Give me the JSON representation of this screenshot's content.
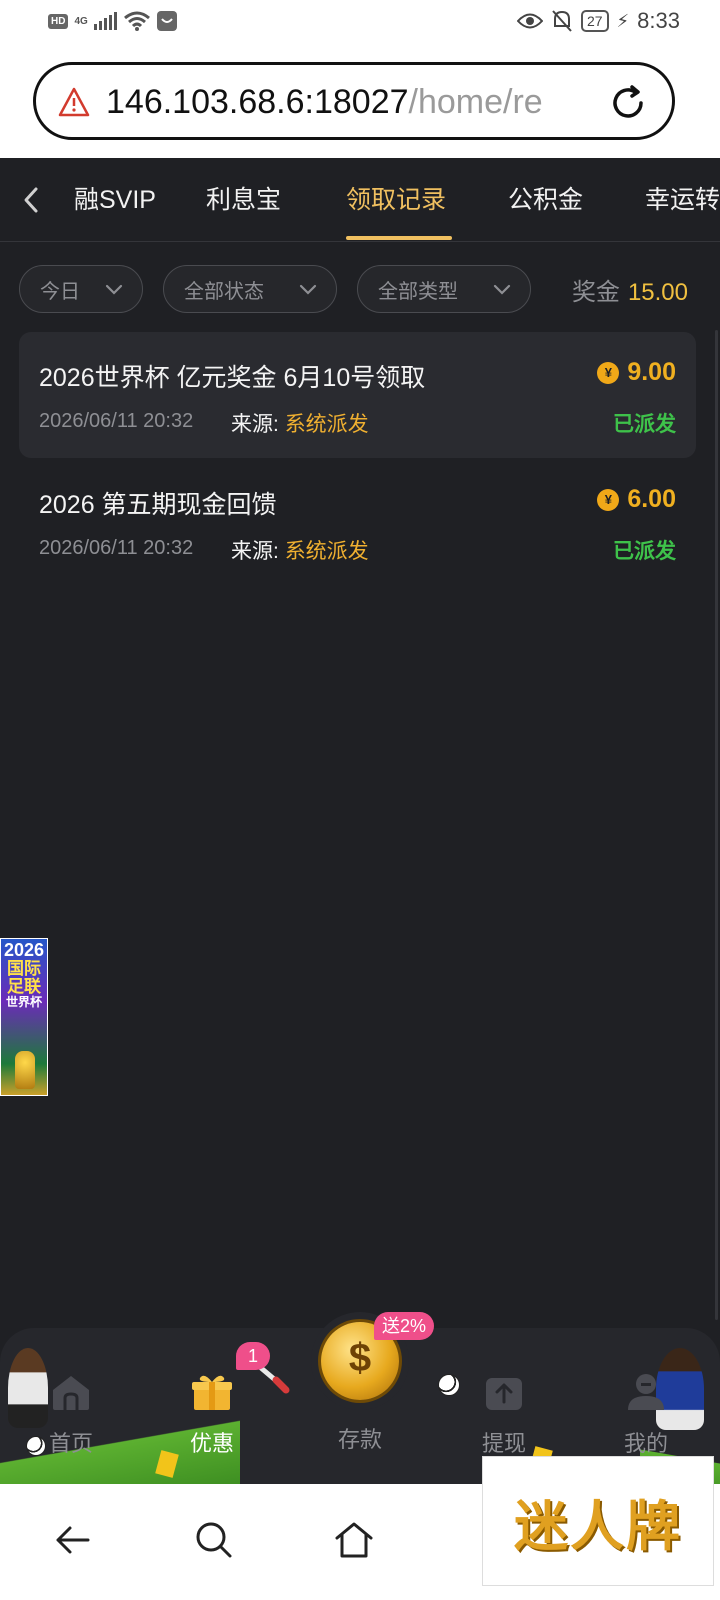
{
  "status_bar": {
    "left_badges": [
      "HD",
      "4G"
    ],
    "battery": "27",
    "time": "8:33"
  },
  "browser": {
    "url_host": "146.103.68.6:18027",
    "url_path": "/home/re"
  },
  "tabs": [
    {
      "label": "融SVIP",
      "active": false
    },
    {
      "label": "利息宝",
      "active": false
    },
    {
      "label": "领取记录",
      "active": true
    },
    {
      "label": "公积金",
      "active": false
    },
    {
      "label": "幸运转",
      "active": false
    }
  ],
  "filters": {
    "date": "今日",
    "status": "全部状态",
    "type": "全部类型"
  },
  "bonus_summary": {
    "label": "奖金",
    "amount": "15.00"
  },
  "records": [
    {
      "title": "2026世界杯 亿元奖金 6月10号领取",
      "amount": "9.00",
      "time": "2026/06/11 20:32",
      "source_label": "来源:",
      "source": "系统派发",
      "status": "已派发"
    },
    {
      "title": "2026 第五期现金回馈",
      "amount": "6.00",
      "time": "2026/06/11 20:32",
      "source_label": "来源:",
      "source": "系统派发",
      "status": "已派发"
    }
  ],
  "side_banner": {
    "year": "2026",
    "line1": "国际",
    "line2": "足联",
    "line3": "世界杯"
  },
  "bottom_nav": {
    "items": [
      {
        "label": "首页",
        "icon": "home-icon",
        "active": false
      },
      {
        "label": "优惠",
        "icon": "gift-icon",
        "active": true,
        "badge": "1"
      },
      {
        "label": "存款",
        "icon": "dollar-coin-icon",
        "active": false,
        "badge": "送2%"
      },
      {
        "label": "提现",
        "icon": "withdraw-icon",
        "active": false
      },
      {
        "label": "我的",
        "icon": "user-icon",
        "active": false
      }
    ]
  },
  "coin_symbol": "¥",
  "watermark": "迷人牌",
  "colors": {
    "accent_gold": "#f0c060",
    "amount_orange": "#f0b020",
    "status_green": "#3ec24a",
    "background": "#1f2024",
    "badge_pink": "#ef4f8a"
  }
}
